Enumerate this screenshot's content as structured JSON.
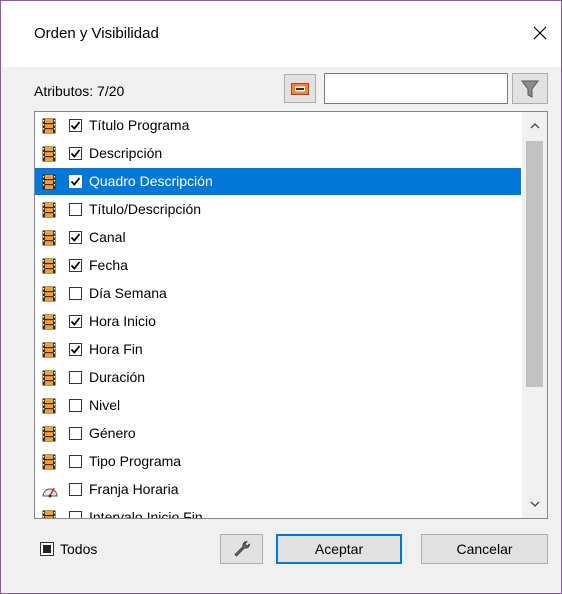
{
  "dialog": {
    "title": "Orden y Visibilidad",
    "close_icon": "close-icon"
  },
  "toolbar": {
    "attributes_label": "Atributos: 7/20",
    "search_value": "",
    "frame_icon": "frame-icon",
    "filter_icon": "filter-funnel-icon"
  },
  "list": {
    "items": [
      {
        "label": "Título Programa",
        "checked": true,
        "icon": "film-icon",
        "selected": false
      },
      {
        "label": "Descripción",
        "checked": true,
        "icon": "film-icon",
        "selected": false
      },
      {
        "label": "Quadro Descripción",
        "checked": true,
        "icon": "film-icon",
        "selected": true
      },
      {
        "label": "Título/Descripción",
        "checked": false,
        "icon": "film-icon",
        "selected": false
      },
      {
        "label": "Canal",
        "checked": true,
        "icon": "film-icon",
        "selected": false
      },
      {
        "label": "Fecha",
        "checked": true,
        "icon": "film-icon",
        "selected": false
      },
      {
        "label": "Día Semana",
        "checked": false,
        "icon": "film-icon",
        "selected": false
      },
      {
        "label": "Hora Inicio",
        "checked": true,
        "icon": "film-icon",
        "selected": false
      },
      {
        "label": "Hora Fin",
        "checked": true,
        "icon": "film-icon",
        "selected": false
      },
      {
        "label": "Duración",
        "checked": false,
        "icon": "film-icon",
        "selected": false
      },
      {
        "label": "Nivel",
        "checked": false,
        "icon": "film-icon",
        "selected": false
      },
      {
        "label": "Género",
        "checked": false,
        "icon": "film-icon",
        "selected": false
      },
      {
        "label": "Tipo Programa",
        "checked": false,
        "icon": "film-icon",
        "selected": false
      },
      {
        "label": "Franja Horaria",
        "checked": false,
        "icon": "gauge-icon",
        "selected": false
      },
      {
        "label": "Intervalo Inicio Fin",
        "checked": false,
        "icon": "film-icon",
        "selected": false
      }
    ]
  },
  "footer": {
    "todos_label": "Todos",
    "tools_icon": "wrench-icon",
    "accept_label": "Aceptar",
    "cancel_label": "Cancelar"
  },
  "colors": {
    "selection": "#0078d7",
    "window_border": "#8b5a9a",
    "dialog_bg": "#f0f0f0"
  }
}
